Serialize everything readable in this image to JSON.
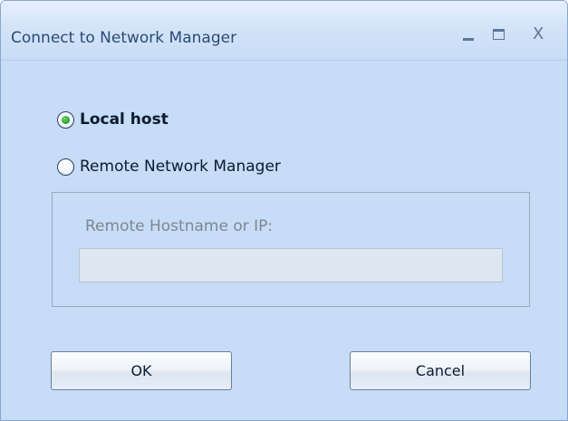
{
  "window": {
    "title": "Connect to Network Manager"
  },
  "title_controls": {
    "minimize_icon": "minimize-icon",
    "maximize_icon": "maximize-icon",
    "close_icon": "close-icon",
    "close_glyph": "X"
  },
  "connection_options": {
    "local": {
      "label": "Local host",
      "selected": true
    },
    "remote": {
      "label": "Remote Network Manager",
      "selected": false
    }
  },
  "remote_group": {
    "field_label": "Remote Hostname or IP:",
    "host_value": "",
    "enabled": false
  },
  "buttons": {
    "ok_label": "OK",
    "cancel_label": "Cancel"
  },
  "colors": {
    "window_background": "#c6dcf7",
    "title_text": "#2c4a75",
    "selected_radio": "#2ea52e",
    "disabled_text": "#7f8791"
  }
}
